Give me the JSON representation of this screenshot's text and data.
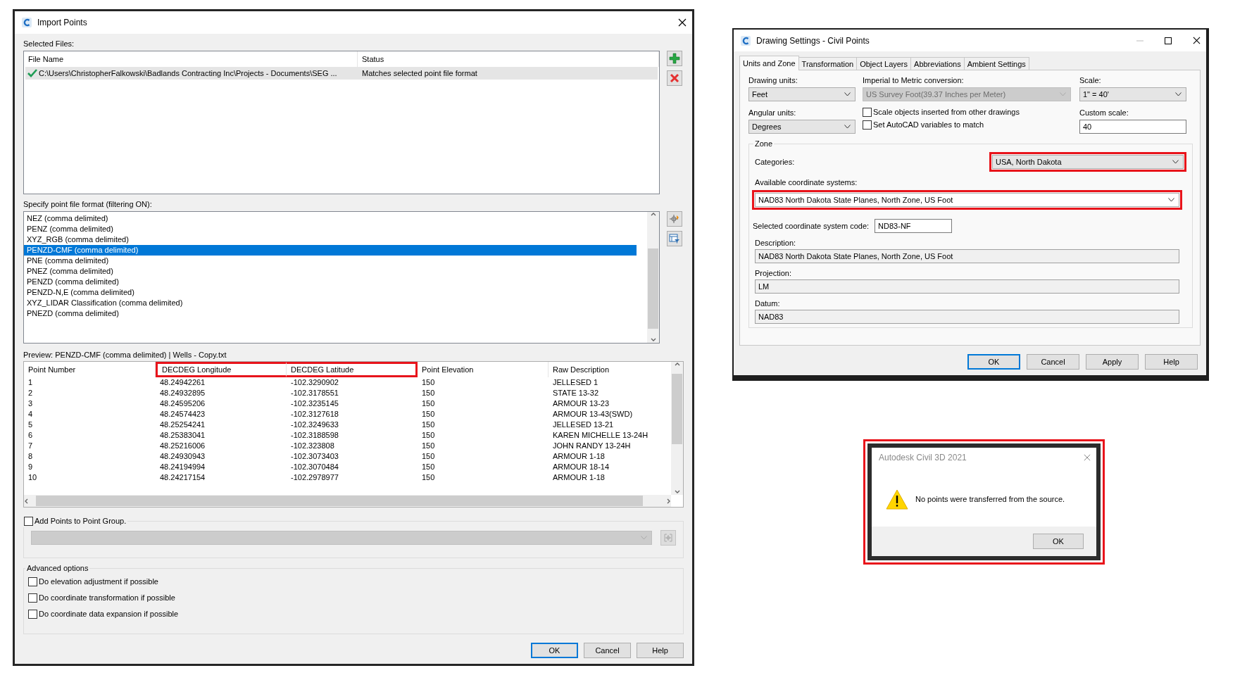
{
  "import_points": {
    "title": "Import Points",
    "selected_files_label": "Selected Files:",
    "file_columns": [
      "File Name",
      "Status"
    ],
    "files": [
      {
        "name": "C:\\Users\\ChristopherFalkowski\\Badlands Contracting Inc\\Projects - Documents\\SEG ...",
        "status": "Matches selected point file format",
        "valid": true,
        "selected": true
      }
    ],
    "format_label": "Specify point file format (filtering ON):",
    "formats": [
      {
        "label": "NEZ (comma delimited)",
        "selected": false
      },
      {
        "label": "PENZ (comma delimited)",
        "selected": false
      },
      {
        "label": "XYZ_RGB (comma delimited)",
        "selected": false
      },
      {
        "label": "PENZD-CMF (comma delimited)",
        "selected": true
      },
      {
        "label": "PNE (comma delimited)",
        "selected": false
      },
      {
        "label": "PNEZ (comma delimited)",
        "selected": false
      },
      {
        "label": "PENZD (comma delimited)",
        "selected": false
      },
      {
        "label": "PENZD-N,E (comma delimited)",
        "selected": false
      },
      {
        "label": "XYZ_LIDAR Classification (comma delimited)",
        "selected": false
      },
      {
        "label": "PNEZD (comma delimited)",
        "selected": false
      }
    ],
    "preview_label": "Preview: PENZD-CMF (comma delimited) | Wells - Copy.txt",
    "preview_columns": [
      {
        "label": "Point Number",
        "highlighted": false
      },
      {
        "label": "DECDEG Longitude",
        "highlighted": true
      },
      {
        "label": "DECDEG Latitude",
        "highlighted": true
      },
      {
        "label": "Point Elevation",
        "highlighted": false
      },
      {
        "label": "Raw Description",
        "highlighted": false
      }
    ],
    "preview_rows": [
      [
        "1",
        "48.24942261",
        "-102.3290902",
        "150",
        "JELLESED 1"
      ],
      [
        "2",
        "48.24932895",
        "-102.3178551",
        "150",
        "STATE 13-32"
      ],
      [
        "3",
        "48.24595206",
        "-102.3235145",
        "150",
        "ARMOUR 13-23"
      ],
      [
        "4",
        "48.24574423",
        "-102.3127618",
        "150",
        "ARMOUR 13-43(SWD)"
      ],
      [
        "5",
        "48.25254241",
        "-102.3249633",
        "150",
        "JELLESED 13-21"
      ],
      [
        "6",
        "48.25383041",
        "-102.3188598",
        "150",
        "KAREN MICHELLE 13-24H"
      ],
      [
        "7",
        "48.25216006",
        "-102.323808",
        "150",
        "JOHN RANDY 13-24H"
      ],
      [
        "8",
        "48.24930943",
        "-102.3073403",
        "150",
        "ARMOUR 1-18"
      ],
      [
        "9",
        "48.24194994",
        "-102.3070484",
        "150",
        "ARMOUR 18-14"
      ],
      [
        "10",
        "48.24217154",
        "-102.2978977",
        "150",
        "ARMOUR 1-18"
      ]
    ],
    "add_to_group": {
      "label": "Add Points to Point Group.",
      "checked": false
    },
    "advanced_label": "Advanced options",
    "options": [
      {
        "label": "Do elevation adjustment if possible",
        "checked": false
      },
      {
        "label": "Do coordinate transformation if possible",
        "checked": false
      },
      {
        "label": "Do coordinate data expansion if possible",
        "checked": false
      }
    ],
    "buttons": [
      {
        "label": "OK",
        "default": true
      },
      {
        "label": "Cancel",
        "default": false
      },
      {
        "label": "Help",
        "default": false
      }
    ]
  },
  "drawing_settings": {
    "title": "Drawing Settings - Civil Points",
    "tabs": [
      {
        "label": "Units and Zone",
        "selected": true
      },
      {
        "label": "Transformation",
        "selected": false
      },
      {
        "label": "Object Layers",
        "selected": false
      },
      {
        "label": "Abbreviations",
        "selected": false
      },
      {
        "label": "Ambient Settings",
        "selected": false
      }
    ],
    "drawing_units": {
      "label": "Drawing units:",
      "value": "Feet"
    },
    "conversion": {
      "label": "Imperial to Metric conversion:",
      "value": "US Survey Foot(39.37 Inches per Meter)",
      "disabled": true
    },
    "scale": {
      "label": "Scale:",
      "value": "1\" = 40'"
    },
    "angular_units": {
      "label": "Angular units:",
      "value": "Degrees"
    },
    "checkboxes": [
      {
        "label": "Scale objects inserted from other drawings",
        "checked": false
      },
      {
        "label": "Set AutoCAD variables to match",
        "checked": false
      }
    ],
    "custom_scale": {
      "label": "Custom scale:",
      "value": "40"
    },
    "zone_label": "Zone",
    "categories": {
      "label": "Categories:",
      "value": "USA, North Dakota",
      "highlighted": true
    },
    "coordinate_systems": {
      "label": "Available coordinate systems:",
      "value": "NAD83 North Dakota State Planes, North Zone, US Foot",
      "highlighted": true
    },
    "code": {
      "label": "Selected coordinate system code:",
      "value": "ND83-NF"
    },
    "description": {
      "label": "Description:",
      "value": "NAD83 North Dakota State Planes, North Zone, US Foot"
    },
    "projection": {
      "label": "Projection:",
      "value": "LM"
    },
    "datum": {
      "label": "Datum:",
      "value": "NAD83"
    },
    "buttons": [
      {
        "label": "OK",
        "default": true
      },
      {
        "label": "Cancel",
        "default": false
      },
      {
        "label": "Apply",
        "default": false
      },
      {
        "label": "Help",
        "default": false
      }
    ]
  },
  "alert": {
    "title": "Autodesk Civil 3D 2021",
    "message": "No points were transferred from the source.",
    "button": "OK",
    "highlighted": true
  }
}
